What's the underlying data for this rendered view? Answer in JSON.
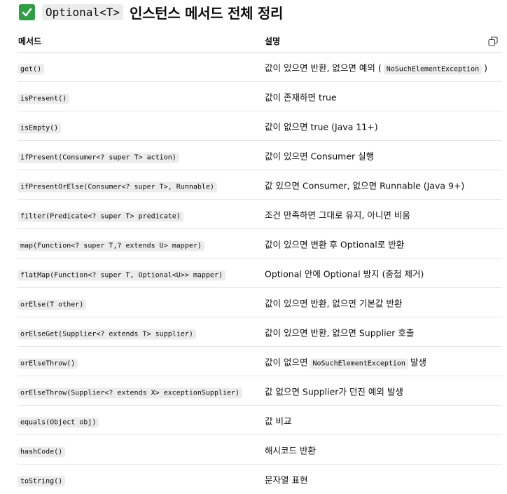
{
  "heading": {
    "icon": "check-mark-icon",
    "icon_color": "#2ea043",
    "code": "Optional<T>",
    "text": "인스턴스 메서드 전체 정리"
  },
  "table": {
    "columns": [
      "메서드",
      "설명"
    ],
    "copy_icon": "copy-icon",
    "rows": [
      {
        "method": "get()",
        "desc_before": "값이 있으면 반환, 없으면 예외 (",
        "desc_code": "NoSuchElementException",
        "desc_after": ")"
      },
      {
        "method": "isPresent()",
        "desc_before": "값이 존재하면 true",
        "desc_code": "",
        "desc_after": ""
      },
      {
        "method": "isEmpty()",
        "desc_before": "값이 없으면 true (Java 11+)",
        "desc_code": "",
        "desc_after": ""
      },
      {
        "method": "ifPresent(Consumer<? super T> action)",
        "desc_before": "값이 있으면 Consumer 실행",
        "desc_code": "",
        "desc_after": ""
      },
      {
        "method": "ifPresentOrElse(Consumer<? super T>, Runnable)",
        "desc_before": "값 있으면 Consumer, 없으면 Runnable (Java 9+)",
        "desc_code": "",
        "desc_after": ""
      },
      {
        "method": "filter(Predicate<? super T> predicate)",
        "desc_before": "조건 만족하면 그대로 유지, 아니면 비움",
        "desc_code": "",
        "desc_after": ""
      },
      {
        "method": "map(Function<? super T,? extends U> mapper)",
        "desc_before": "값이 있으면 변환 후 Optional로 반환",
        "desc_code": "",
        "desc_after": ""
      },
      {
        "method": "flatMap(Function<? super T, Optional<U>> mapper)",
        "desc_before": "Optional 안에 Optional 방지 (중첩 제거)",
        "desc_code": "",
        "desc_after": ""
      },
      {
        "method": "orElse(T other)",
        "desc_before": "값이 있으면 반환, 없으면 기본값 반환",
        "desc_code": "",
        "desc_after": ""
      },
      {
        "method": "orElseGet(Supplier<? extends T> supplier)",
        "desc_before": "값이 있으면 반환, 없으면 Supplier 호출",
        "desc_code": "",
        "desc_after": ""
      },
      {
        "method": "orElseThrow()",
        "desc_before": "값이 없으면",
        "desc_code": "NoSuchElementException",
        "desc_after": "발생"
      },
      {
        "method": "orElseThrow(Supplier<? extends X> exceptionSupplier)",
        "desc_before": "값 없으면 Supplier가 던진 예외 발생",
        "desc_code": "",
        "desc_after": ""
      },
      {
        "method": "equals(Object obj)",
        "desc_before": "값 비교",
        "desc_code": "",
        "desc_after": ""
      },
      {
        "method": "hashCode()",
        "desc_before": "해시코드 반환",
        "desc_code": "",
        "desc_after": ""
      },
      {
        "method": "toString()",
        "desc_before": "문자열 표현",
        "desc_code": "",
        "desc_after": ""
      }
    ]
  }
}
